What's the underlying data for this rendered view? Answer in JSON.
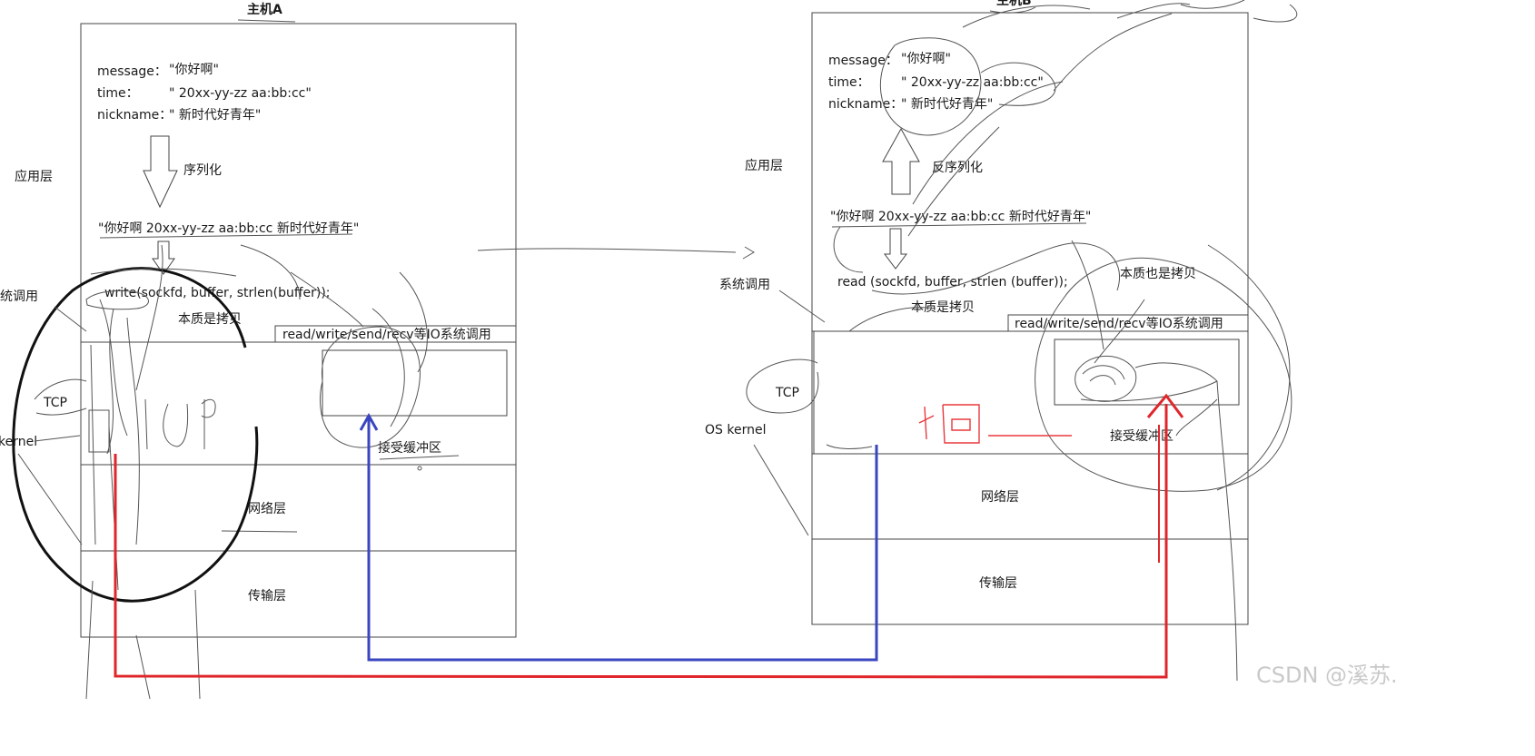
{
  "host_a": {
    "title": "主机A",
    "message_label": "message：",
    "message_value": "\"你好啊\"",
    "time_label": "time：",
    "time_value": "\" 20xx-yy-zz aa:bb:cc\"",
    "nickname_label": "nickname：",
    "nickname_value": "\" 新时代好青年\"",
    "serialize_label": "序列化",
    "serialized_string": "\"你好啊 20xx-yy-zz aa:bb:cc 新时代好青年\"",
    "write_call": "write(sockfd, buffer, strlen(buffer));",
    "copy_note": "本质是拷贝",
    "io_label": "read/write/send/recv等IO系统调用",
    "recv_buffer_label": "接受缓冲区",
    "network_layer": "网络层",
    "transport_layer": "传输层"
  },
  "host_b": {
    "title": "主机B",
    "message_label": "message：",
    "message_value": "\"你好啊\"",
    "time_label": "time：",
    "time_value": "\" 20xx-yy-zz aa:bb:cc\"",
    "nickname_label": "nickname：",
    "nickname_value": "\" 新时代好青年\"",
    "deserialize_label": "反序列化",
    "serialized_string": "\"你好啊 20xx-yy-zz aa:bb:cc 新时代好青年\"",
    "read_call": "read (sockfd, buffer, strlen (buffer));",
    "copy_note": "本质是拷贝",
    "copy_note_2": "本质也是拷贝",
    "io_label": "read/write/send/recv等IO系统调用",
    "recv_buffer_label": "接受缓冲区",
    "network_layer": "网络层",
    "transport_layer": "传输层"
  },
  "side_labels": {
    "app_layer_left": "应用层",
    "syscall_left": "统调用",
    "tcp_left": "TCP",
    "kernel_left": "kernel",
    "app_layer_right": "应用层",
    "syscall_right": "系统调用",
    "tcp_right": "TCP",
    "os_kernel_right": "OS kernel"
  },
  "watermark": "CSDN @溪苏.",
  "colors": {
    "blue_arrow": "#3a46c0",
    "red_arrow": "#e0262b",
    "red_scribble": "#e8383c",
    "ink": "#1a1a1a"
  }
}
